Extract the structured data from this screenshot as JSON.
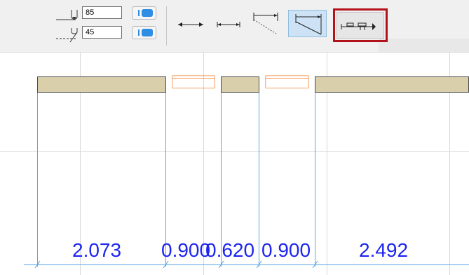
{
  "toolbar": {
    "upper_value": "85",
    "lower_value": "45",
    "colors": {
      "toggle_tick": "#2f8de4",
      "toggle_pill": "#2f8de4",
      "selected_bg": "#cde3f5",
      "highlight_frame": "#b3121a"
    },
    "icons": [
      "upper-offset-icon",
      "lower-offset-icon",
      "dimension-arrow-icon",
      "dimension-short-arrow-icon",
      "dimension-slanted-icon",
      "dimension-slanted-filled-icon",
      "dimension-marker-icon"
    ]
  },
  "dimensions": [
    {
      "label": "2.073"
    },
    {
      "label": "0.900"
    },
    {
      "label": "0.620"
    },
    {
      "label": "0.900"
    },
    {
      "label": "2.492"
    }
  ],
  "colors": {
    "wall_fill": "#d9cfab",
    "opening_line": "#f08030",
    "dimension_line": "#5aa7e6",
    "dimension_text": "#1d25f0",
    "grid": "#d8d8d8"
  }
}
